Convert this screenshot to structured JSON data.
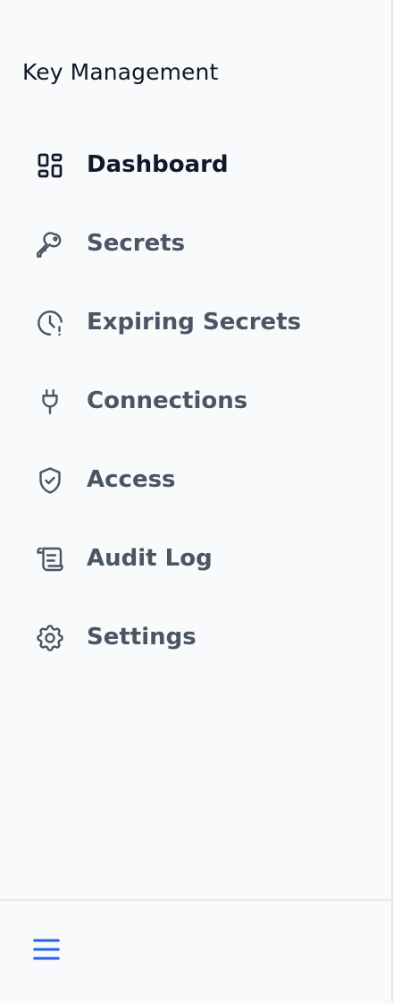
{
  "app": {
    "title": "Key Management"
  },
  "sidebar": {
    "items": [
      {
        "label": "Dashboard",
        "icon": "dashboard-grid-icon",
        "active": true
      },
      {
        "label": "Secrets",
        "icon": "key-icon",
        "active": false
      },
      {
        "label": "Expiring Secrets",
        "icon": "clock-alert-icon",
        "active": false
      },
      {
        "label": "Connections",
        "icon": "plug-icon",
        "active": false
      },
      {
        "label": "Access",
        "icon": "shield-check-icon",
        "active": false
      },
      {
        "label": "Audit Log",
        "icon": "scroll-icon",
        "active": false
      },
      {
        "label": "Settings",
        "icon": "gear-icon",
        "active": false
      }
    ]
  },
  "footer": {
    "menu_icon": "hamburger-menu-icon"
  },
  "colors": {
    "background": "#f8fafc",
    "active_text": "#111827",
    "inactive_text": "#4b5563",
    "accent": "#2563eb",
    "border": "#e5e7eb"
  }
}
